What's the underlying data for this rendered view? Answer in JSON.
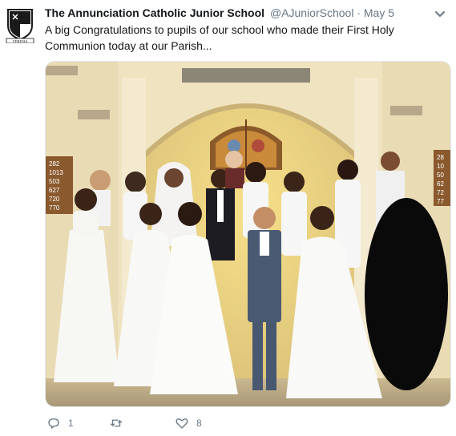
{
  "tweet": {
    "author_name": "The Annunciation Catholic Junior School",
    "author_handle": "@AJuniorSchool",
    "separator": "·",
    "date": "May 5",
    "text": "A big Congratulations to pupils of our school who made their First Holy Communion today at our Parish...",
    "avatar_motto": "VERITAS"
  },
  "hymn_board": {
    "left": [
      "282",
      "1013",
      "503",
      "627",
      "720",
      "770"
    ],
    "right": [
      "28",
      "10",
      "50",
      "62",
      "72",
      "77"
    ]
  },
  "actions": {
    "reply_count": "1",
    "retweet_count": "",
    "like_count": "8"
  },
  "colors": {
    "text": "#14171a",
    "muted": "#657786",
    "wall": "#e8d49a",
    "dress": "#f7f7f4",
    "suit_blue": "#4a5a73",
    "dark_suit": "#1c1c22"
  }
}
